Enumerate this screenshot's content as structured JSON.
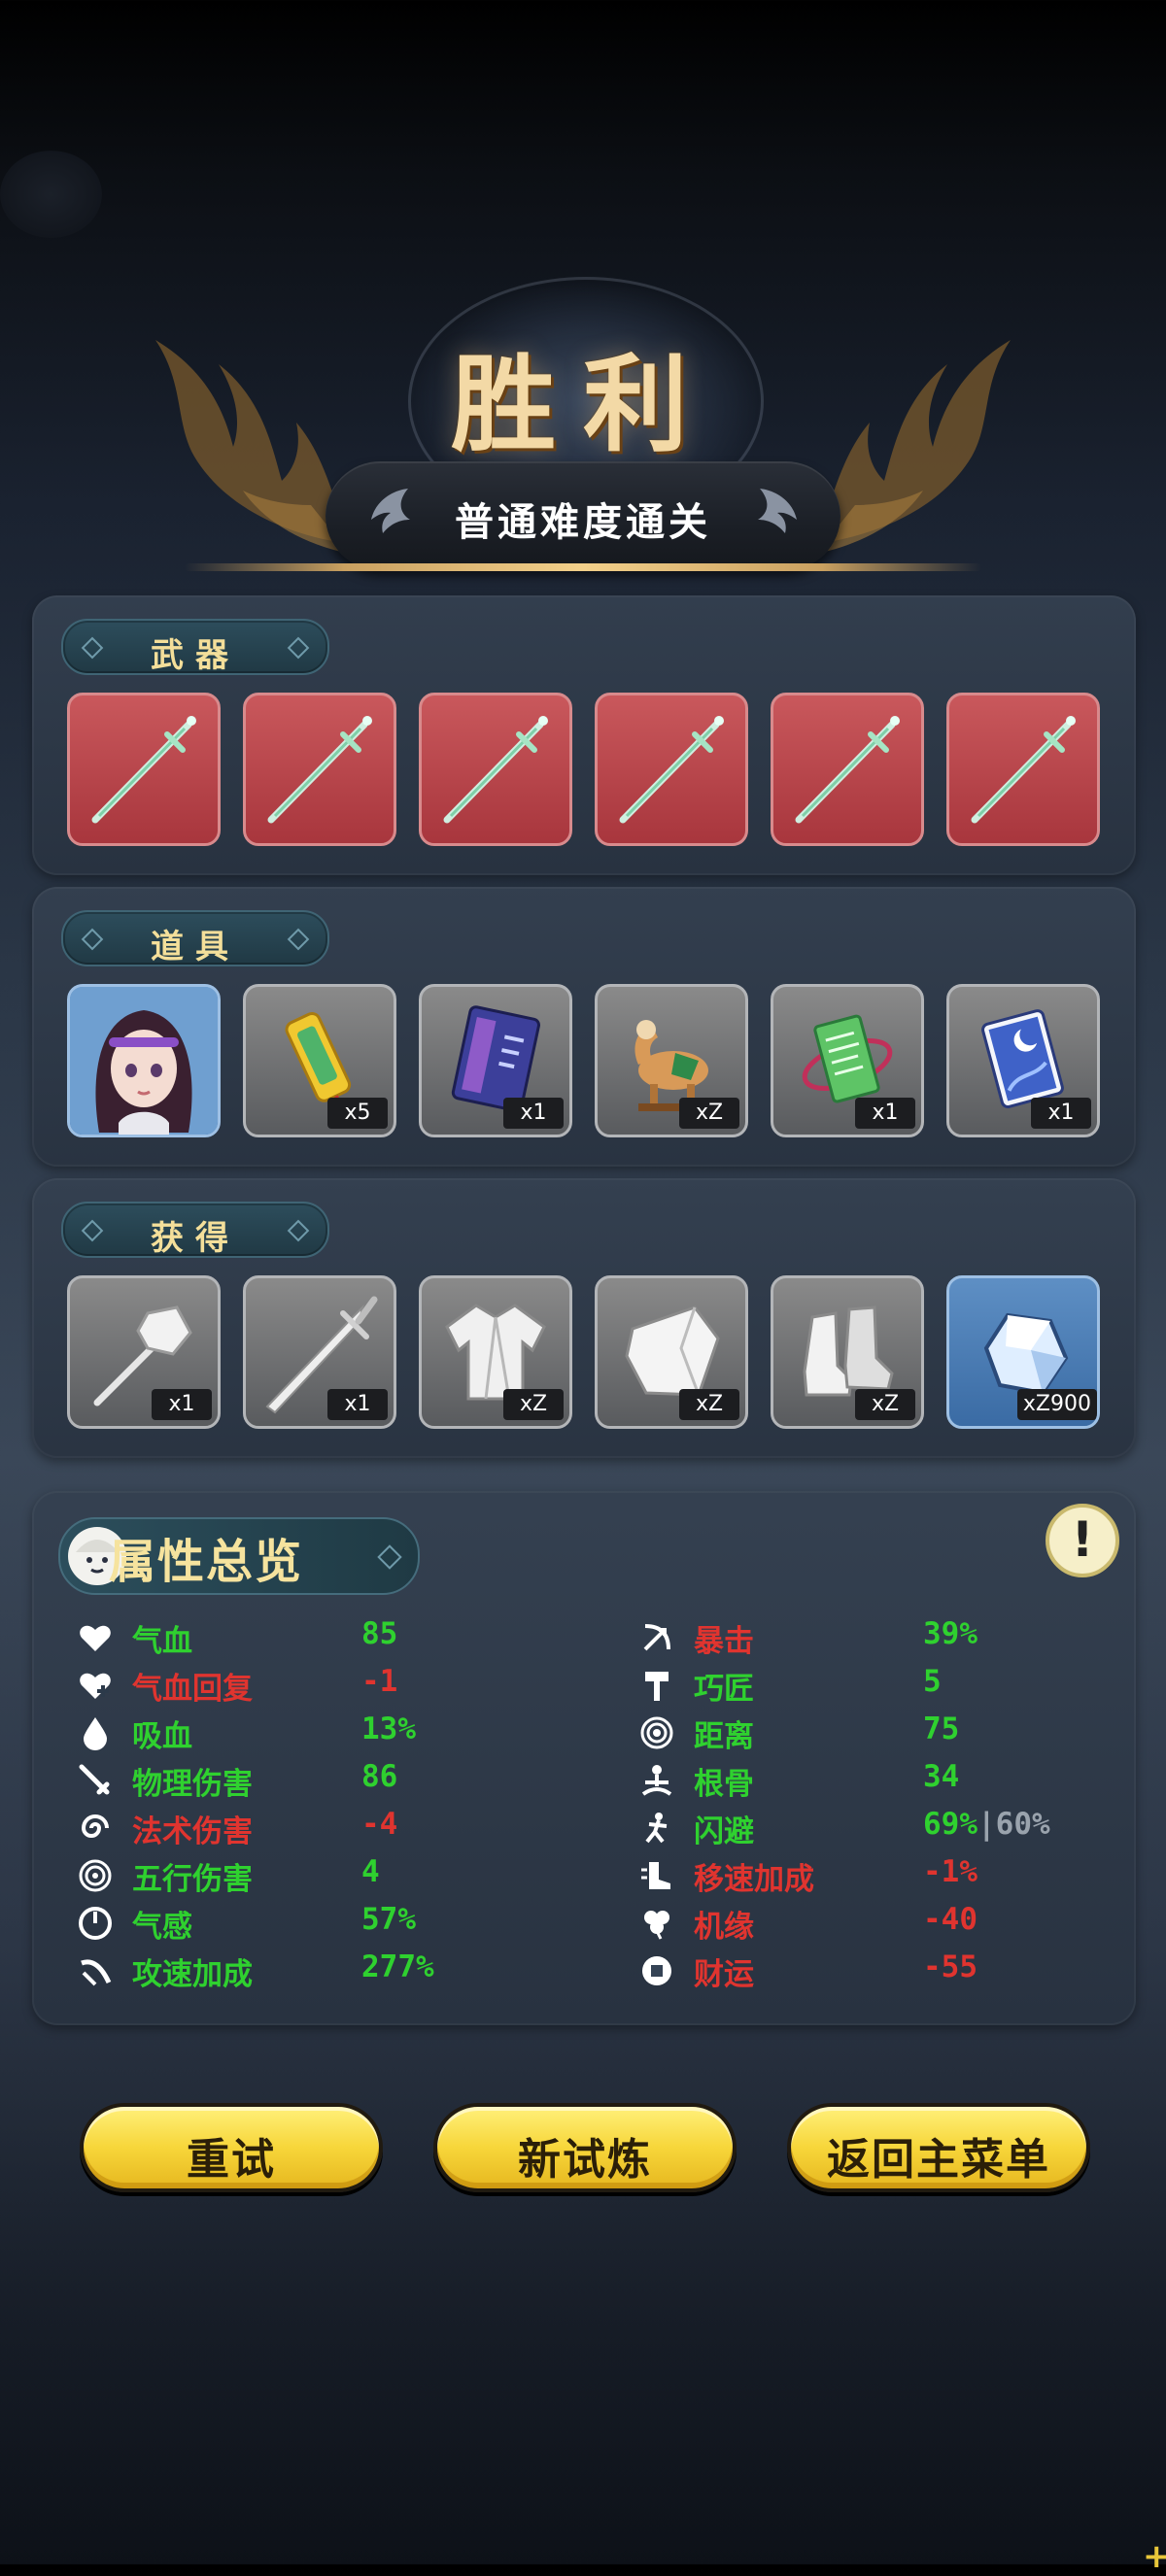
{
  "header": {
    "title": "胜利",
    "subtitle": "普通难度通关"
  },
  "sections": {
    "weapons": {
      "label": "武器",
      "items": [
        {
          "icon": "jade-sword-icon"
        },
        {
          "icon": "jade-sword-icon"
        },
        {
          "icon": "jade-sword-icon"
        },
        {
          "icon": "jade-sword-icon"
        },
        {
          "icon": "jade-sword-icon"
        },
        {
          "icon": "jade-sword-icon"
        }
      ]
    },
    "props": {
      "label": "道具",
      "items": [
        {
          "icon": "character-portrait-icon",
          "qty": ""
        },
        {
          "icon": "golden-talisman-icon",
          "qty": "x5"
        },
        {
          "icon": "blue-book-icon",
          "qty": "x1"
        },
        {
          "icon": "horse-statue-icon",
          "qty": "xZ"
        },
        {
          "icon": "green-scroll-icon",
          "qty": "x1"
        },
        {
          "icon": "moon-card-icon",
          "qty": "x1"
        }
      ]
    },
    "obtained": {
      "label": "获得",
      "items": [
        {
          "icon": "hammer-icon",
          "qty": "x1"
        },
        {
          "icon": "sword-icon",
          "qty": "x1"
        },
        {
          "icon": "robe-icon",
          "qty": "xZ"
        },
        {
          "icon": "bracer-icon",
          "qty": "xZ"
        },
        {
          "icon": "boots-icon",
          "qty": "xZ"
        },
        {
          "icon": "crystal-icon",
          "qty": "xZ900"
        }
      ]
    }
  },
  "attributes": {
    "title": "属性总览",
    "info_icon": "!",
    "left": [
      {
        "name": "气血",
        "value": "85",
        "color": "green",
        "icon": "heart-icon"
      },
      {
        "name": "气血回复",
        "value": "-1",
        "color": "red",
        "icon": "heart-regen-icon"
      },
      {
        "name": "吸血",
        "value": "13%",
        "color": "green",
        "icon": "blood-drop-icon"
      },
      {
        "name": "物理伤害",
        "value": "86",
        "color": "green",
        "icon": "blade-icon"
      },
      {
        "name": "法术伤害",
        "value": "-4",
        "color": "red",
        "icon": "swirl-icon"
      },
      {
        "name": "五行伤害",
        "value": "4",
        "color": "green",
        "icon": "spiral-icon"
      },
      {
        "name": "气感",
        "value": "57%",
        "color": "green",
        "icon": "power-icon"
      },
      {
        "name": "攻速加成",
        "value": "277%",
        "color": "green",
        "icon": "slash-speed-icon"
      }
    ],
    "right": [
      {
        "name": "暴击",
        "value": "39%",
        "color": "red",
        "value_color": "green",
        "icon": "crit-bow-icon"
      },
      {
        "name": "巧匠",
        "value": "5",
        "color": "green",
        "icon": "hammer-tool-icon"
      },
      {
        "name": "距离",
        "value": "75",
        "color": "green",
        "icon": "range-rings-icon"
      },
      {
        "name": "根骨",
        "value": "34",
        "color": "green",
        "icon": "meditate-icon"
      },
      {
        "name": "闪避",
        "value": "69%",
        "extra": "|60%",
        "color": "green",
        "icon": "dodge-icon"
      },
      {
        "name": "移速加成",
        "value": "-1%",
        "color": "red",
        "icon": "boot-speed-icon"
      },
      {
        "name": "机缘",
        "value": "-40",
        "color": "red",
        "icon": "clover-icon"
      },
      {
        "name": "财运",
        "value": "-55",
        "color": "red",
        "icon": "coin-icon"
      }
    ]
  },
  "buttons": {
    "retry": "重试",
    "new_trial": "新试炼",
    "main_menu": "返回主菜单"
  },
  "corner_mark": "+"
}
